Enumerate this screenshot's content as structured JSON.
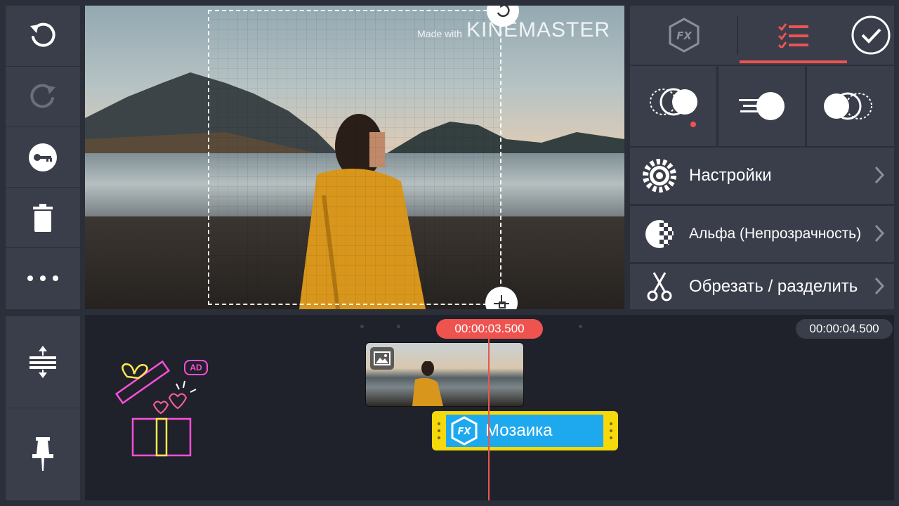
{
  "preview": {
    "watermark_small": "Made with",
    "watermark_brand": "KINEMASTER"
  },
  "right_panel": {
    "menu": [
      {
        "label": "Настройки",
        "icon": "gear-icon"
      },
      {
        "label": "Альфа (Непрозрачность)",
        "icon": "alpha-icon"
      },
      {
        "label": "Обрезать / разделить",
        "icon": "scissors-icon"
      }
    ]
  },
  "timeline": {
    "current_time": "00:00:03.500",
    "end_time": "00:00:04.500",
    "fx_label": "Мозаика",
    "ad_badge": "AD"
  },
  "colors": {
    "accent": "#ef5350",
    "fx_track": "#f5d90a",
    "fx_inner": "#1ea9ee",
    "panel": "#3a3e4a",
    "background": "#2b2f3a"
  }
}
